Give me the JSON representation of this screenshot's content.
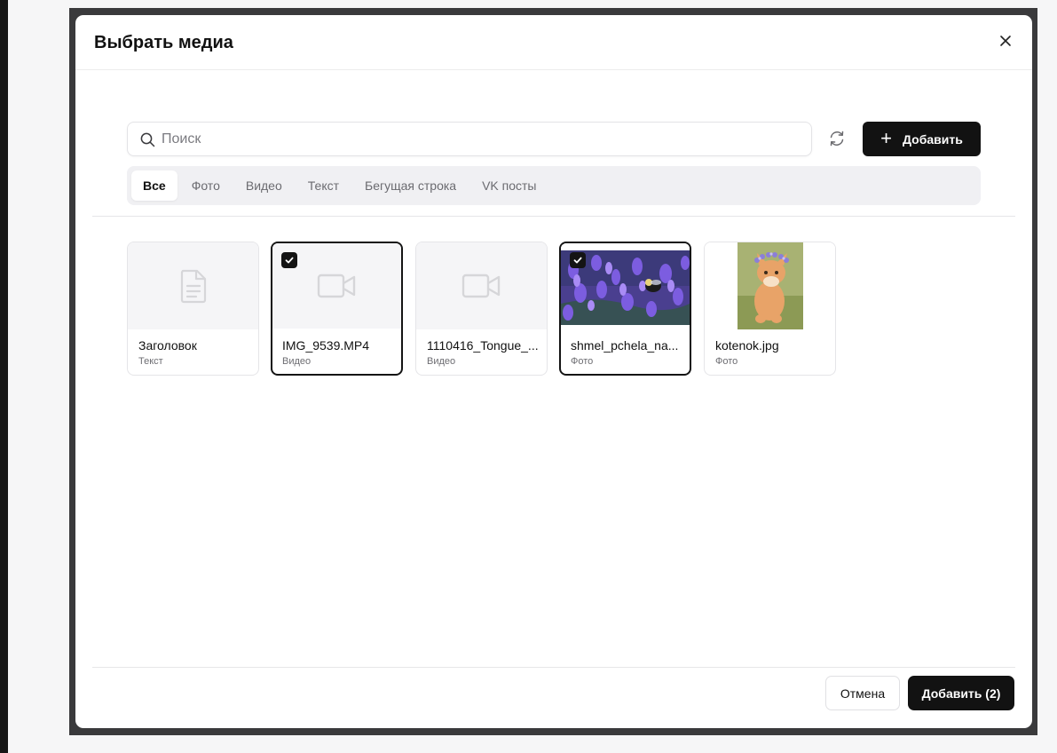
{
  "dialog": {
    "title": "Выбрать медиа",
    "close_icon": "close-icon"
  },
  "search": {
    "placeholder": "Поиск",
    "value": ""
  },
  "toolbar": {
    "refresh_icon": "refresh-icon",
    "add_label": "Добавить"
  },
  "tabs": [
    {
      "label": "Все",
      "active": true
    },
    {
      "label": "Фото",
      "active": false
    },
    {
      "label": "Видео",
      "active": false
    },
    {
      "label": "Текст",
      "active": false
    },
    {
      "label": "Бегущая строка",
      "active": false
    },
    {
      "label": "VK посты",
      "active": false
    }
  ],
  "media": [
    {
      "name": "Заголовок",
      "type": "Текст",
      "selected": false,
      "icon": "document-icon"
    },
    {
      "name": "IMG_9539.MP4",
      "type": "Видео",
      "selected": true,
      "icon": "video-icon"
    },
    {
      "name": "1110416_Tongue_...",
      "type": "Видео",
      "selected": false,
      "icon": "video-icon"
    },
    {
      "name": "shmel_pchela_na...",
      "type": "Фото",
      "selected": true,
      "icon": "photo-thumbnail"
    },
    {
      "name": "kotenok.jpg",
      "type": "Фото",
      "selected": false,
      "icon": "photo-thumbnail"
    }
  ],
  "footer": {
    "cancel_label": "Отмена",
    "confirm_label": "Добавить (2)"
  },
  "colors": {
    "primary": "#121212",
    "tab_background": "#f0f0f3",
    "thumb_background": "#f5f5f7",
    "backdrop": "#3a3a3c"
  }
}
